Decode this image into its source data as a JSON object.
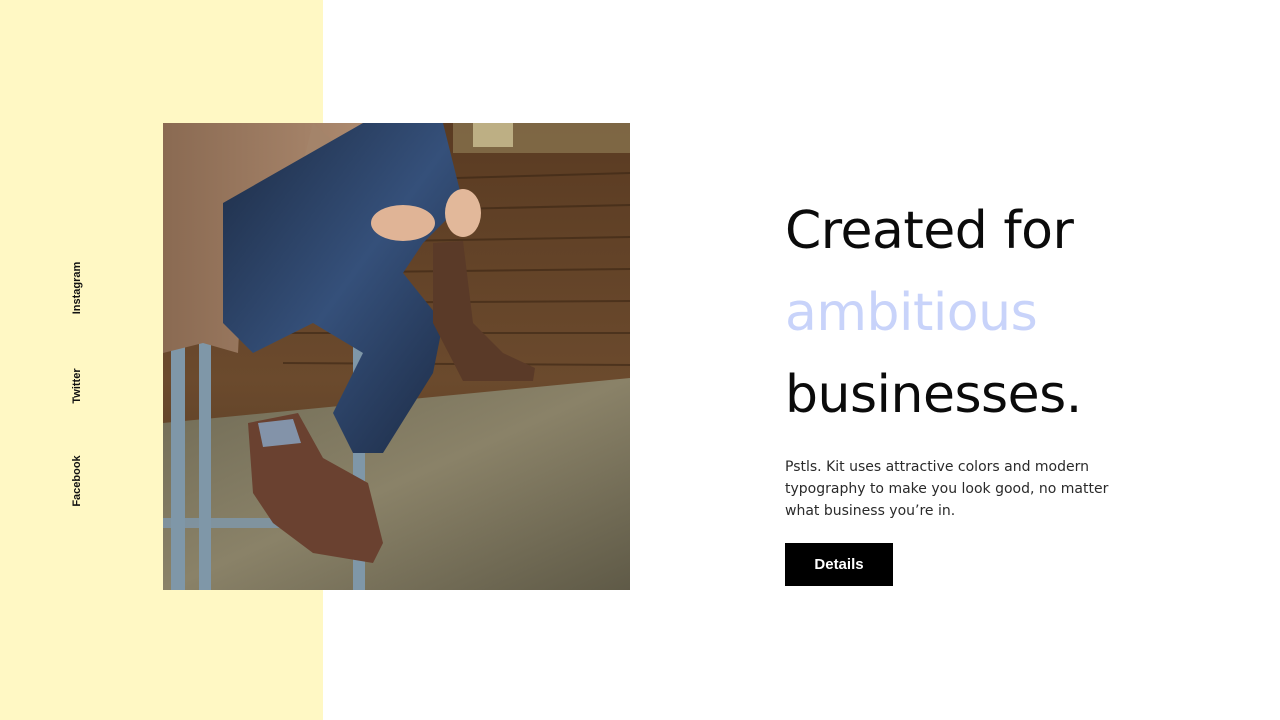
{
  "colors": {
    "side_panel": "#fff8c4",
    "accent_word": "#c8d3fa",
    "button_bg": "#000000",
    "button_text": "#ffffff"
  },
  "social": {
    "links": [
      {
        "label": "Instagram",
        "icon": "instagram-link"
      },
      {
        "label": "Twitter",
        "icon": "twitter-link"
      },
      {
        "label": "Facebook",
        "icon": "facebook-link"
      }
    ]
  },
  "hero": {
    "headline_line1": "Created for",
    "headline_accent": "ambitious",
    "headline_line3": "businesses.",
    "description": "Pstls. Kit uses attractive colors and modern typography to make you look good, no matter what business you’re in.",
    "button_label": "Details"
  },
  "image": {
    "subject": "person-sitting-on-stool-photo"
  }
}
